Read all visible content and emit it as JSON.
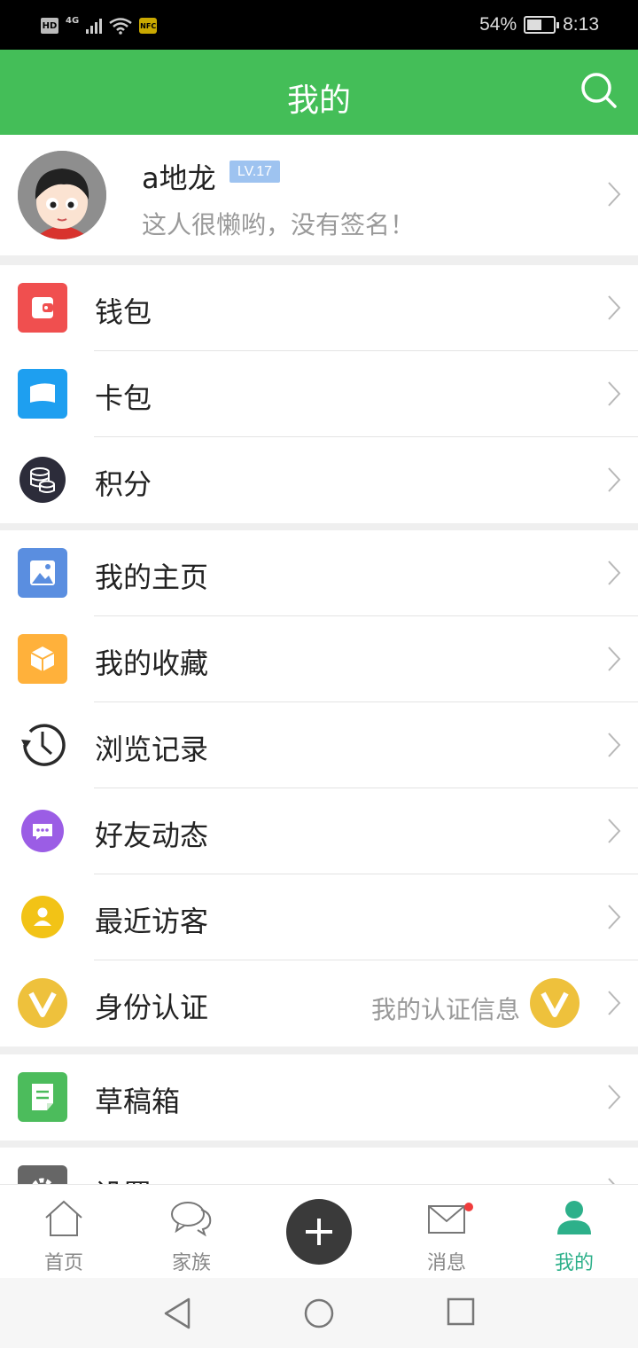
{
  "status_bar": {
    "hd": "HD",
    "network": "4G",
    "battery": "54%",
    "time": "8:13"
  },
  "header": {
    "title": "我的"
  },
  "profile": {
    "username": "a地龙",
    "level": "LV.17",
    "signature": "这人很懒哟，没有签名！"
  },
  "groups": {
    "g1": [
      {
        "label": "钱包",
        "icon": "wallet-icon",
        "color": "#f04f4f"
      },
      {
        "label": "卡包",
        "icon": "card-icon",
        "color": "#1e9ff0"
      },
      {
        "label": "积分",
        "icon": "coins-icon",
        "color": "#2c2c3a"
      }
    ],
    "g2": [
      {
        "label": "我的主页",
        "icon": "image-icon",
        "color": "#5a8ee0"
      },
      {
        "label": "我的收藏",
        "icon": "box-icon",
        "color": "#ffb13b"
      },
      {
        "label": "浏览记录",
        "icon": "history-icon",
        "color": "#2a2a2a"
      },
      {
        "label": "好友动态",
        "icon": "chat-icon",
        "color": "#9b5de5"
      },
      {
        "label": "最近访客",
        "icon": "visitor-icon",
        "color": "#f2c316"
      },
      {
        "label": "身份认证",
        "icon": "verify-icon",
        "color": "#eec13c",
        "info": "我的认证信息"
      }
    ],
    "g3": [
      {
        "label": "草稿箱",
        "icon": "draft-icon",
        "color": "#4cbc5c"
      }
    ],
    "g4": [
      {
        "label": "设置",
        "icon": "gear-icon",
        "color": "#666666"
      }
    ]
  },
  "tabbar": {
    "home": "首页",
    "family": "家族",
    "messages": "消息",
    "mine": "我的"
  },
  "colors": {
    "brand": "#44be58",
    "active_tab": "#2db08a",
    "notification_dot": "#f03c3c"
  }
}
